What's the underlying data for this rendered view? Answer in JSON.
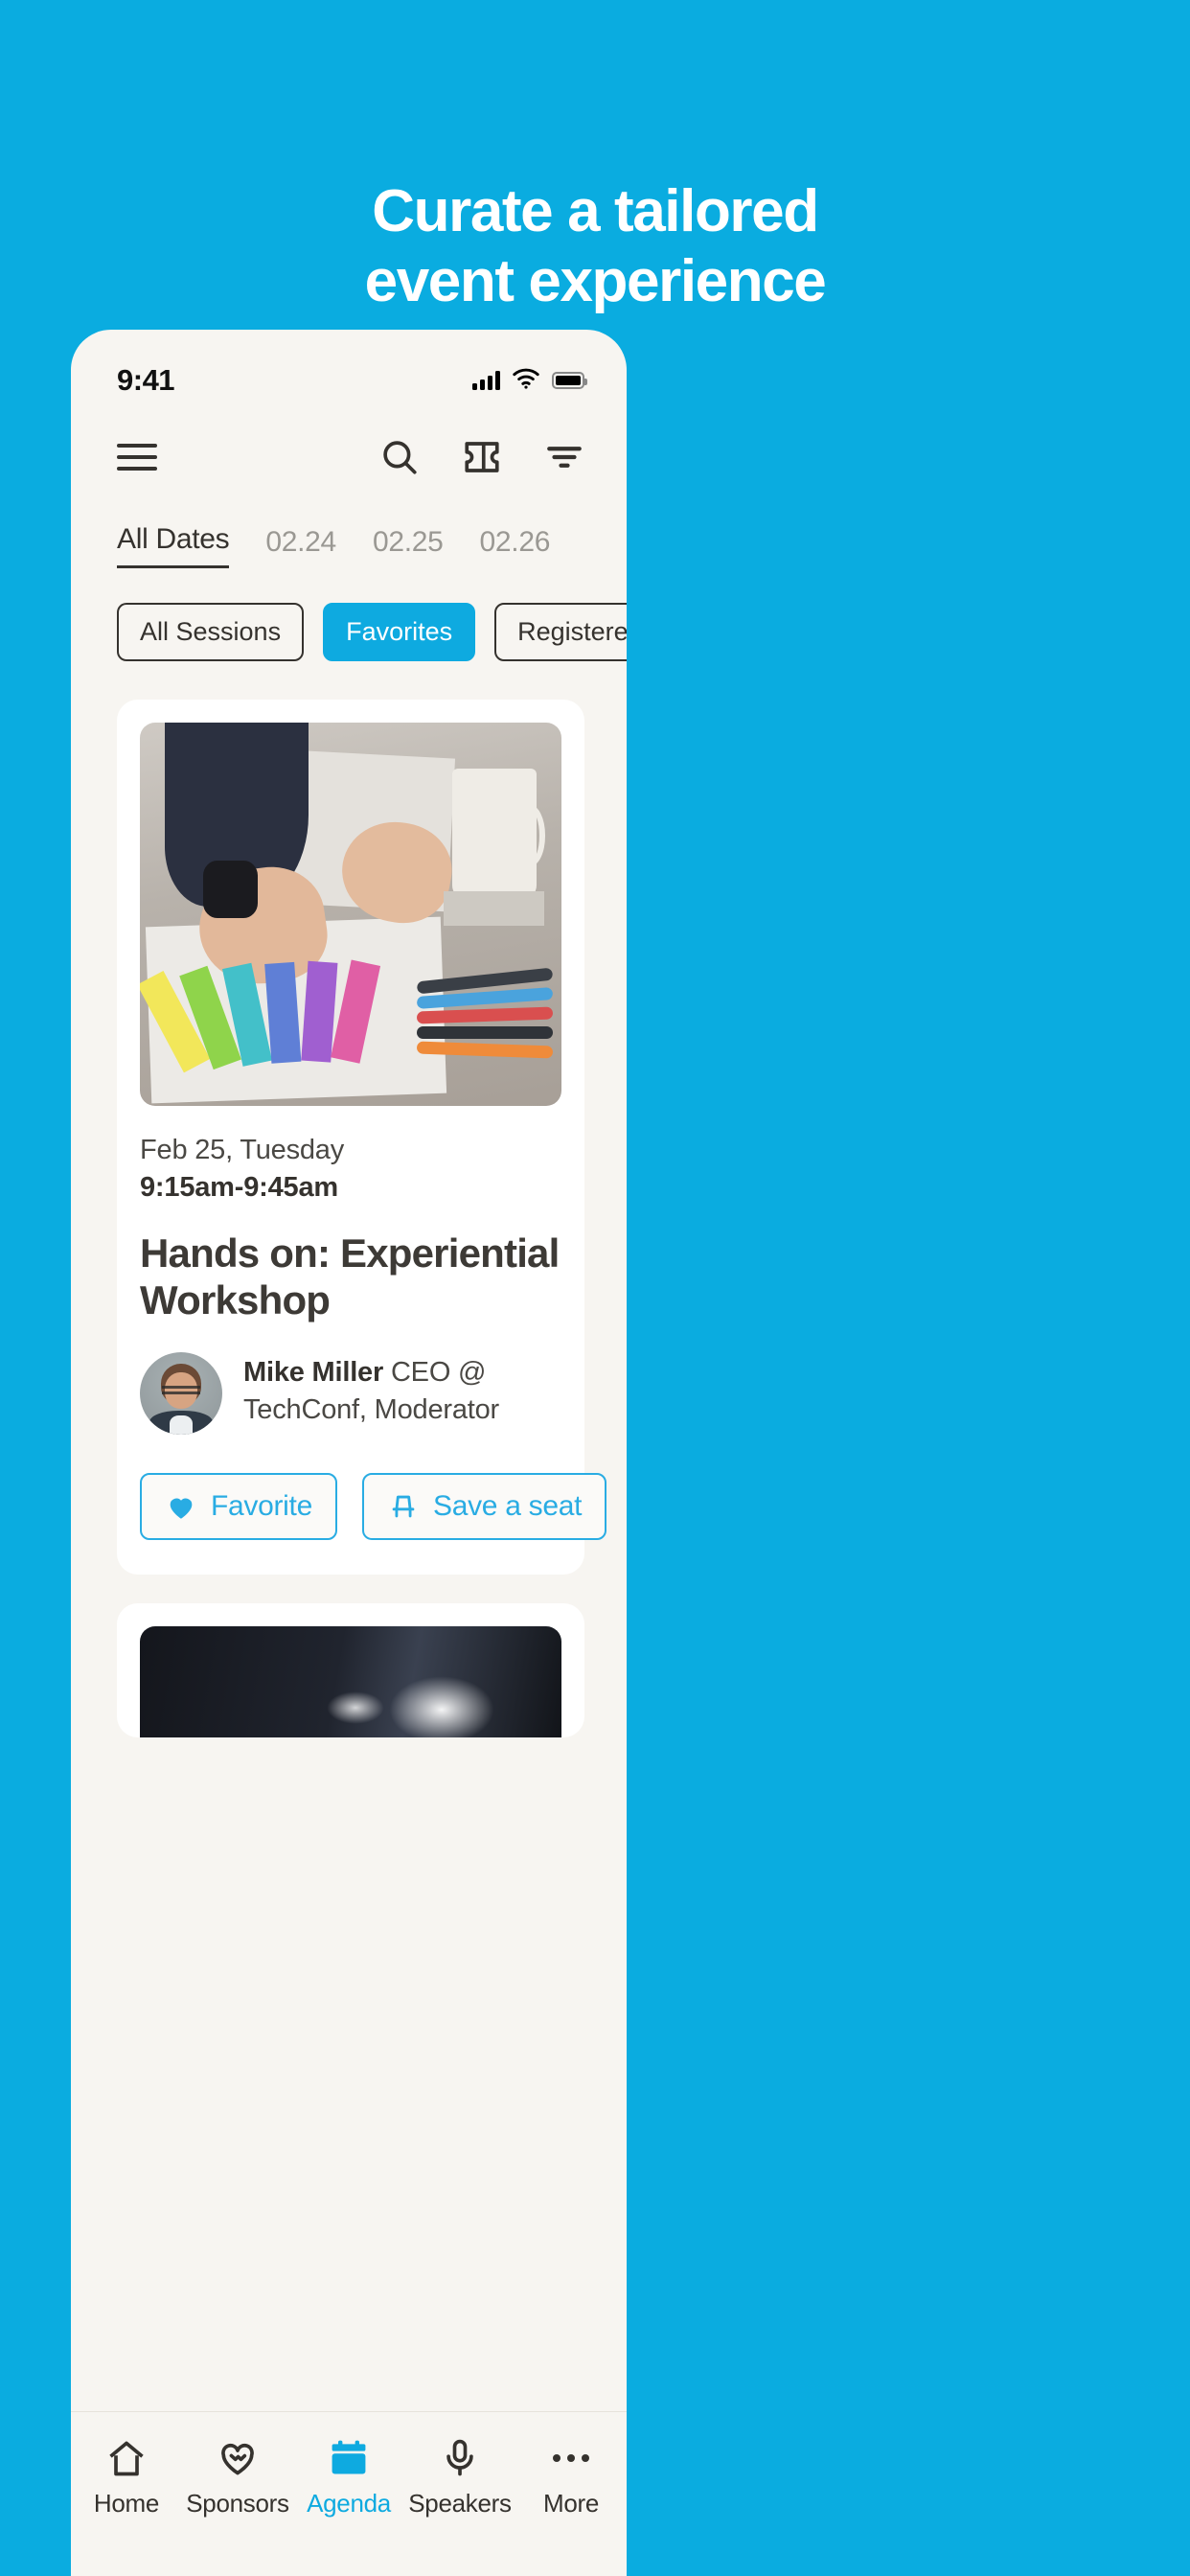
{
  "headline": {
    "line1": "Curate a tailored",
    "line2": "event experience"
  },
  "colors": {
    "brand_blue": "#0aace0",
    "accent_blue": "#29ace3",
    "app_background": "#f7f5f1",
    "card_background": "#ffffff",
    "text_dark": "#35322e",
    "text_muted": "#9a9893"
  },
  "status_bar": {
    "time": "9:41",
    "signal_icon": "cellular-signal-icon",
    "wifi_icon": "wifi-icon",
    "battery_icon": "battery-full-icon"
  },
  "app_header": {
    "menu_icon": "hamburger-menu-icon",
    "search_icon": "search-icon",
    "ticket_icon": "ticket-icon",
    "filter_icon": "filter-icon"
  },
  "date_tabs": [
    {
      "label": "All Dates",
      "active": true
    },
    {
      "label": "02.24",
      "active": false
    },
    {
      "label": "02.25",
      "active": false
    },
    {
      "label": "02.26",
      "active": false
    }
  ],
  "filter_chips": [
    {
      "label": "All Sessions",
      "selected": false
    },
    {
      "label": "Favorites",
      "selected": true
    },
    {
      "label": "Registered",
      "selected": false
    }
  ],
  "session_card": {
    "image_alt": "designer-hands-color-swatches-desk-photo",
    "date": "Feb 25, Tuesday",
    "time": "9:15am-9:45am",
    "title": "Hands on: Experiential Workshop",
    "speaker": {
      "avatar_alt": "speaker-avatar-photo",
      "name": "Mike Miller",
      "role": "CEO @ TechConf, Moderator"
    },
    "actions": [
      {
        "label": "Favorite",
        "icon": "heart-icon"
      },
      {
        "label": "Save a seat",
        "icon": "chair-icon"
      }
    ]
  },
  "bottom_nav": [
    {
      "label": "Home",
      "icon": "home-icon",
      "active": false
    },
    {
      "label": "Sponsors",
      "icon": "handshake-heart-icon",
      "active": false
    },
    {
      "label": "Agenda",
      "icon": "calendar-icon",
      "active": true
    },
    {
      "label": "Speakers",
      "icon": "microphone-icon",
      "active": false
    },
    {
      "label": "More",
      "icon": "ellipsis-icon",
      "active": false
    }
  ]
}
